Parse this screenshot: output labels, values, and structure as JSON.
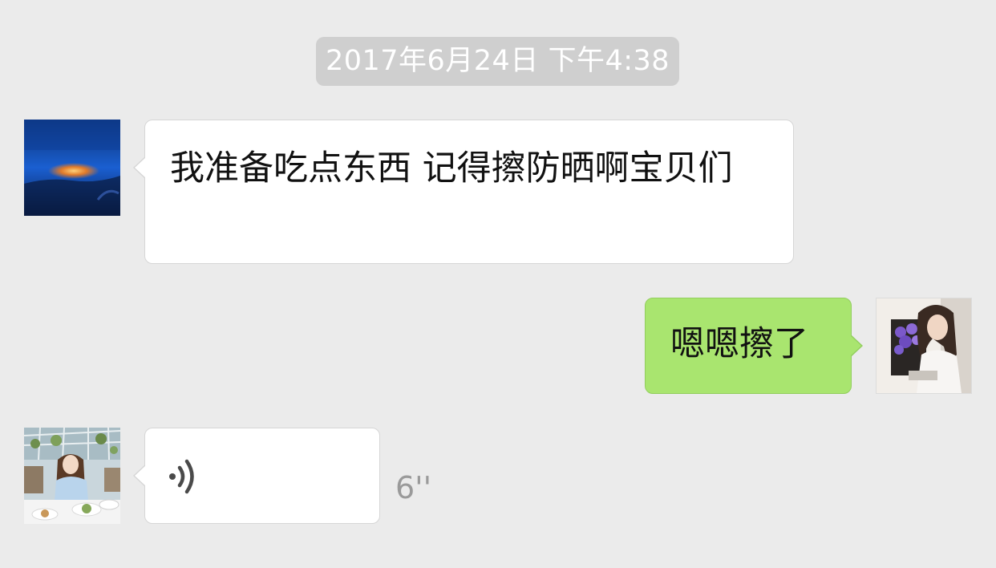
{
  "chat": {
    "timestamp": "2017年6月24日 下午4:38",
    "messages": [
      {
        "side": "left",
        "type": "text",
        "text": "我准备吃点东西 记得擦防晒啊宝贝们"
      },
      {
        "side": "right",
        "type": "text",
        "text": "嗯嗯擦了"
      },
      {
        "side": "left",
        "type": "voice",
        "duration": "6''",
        "icon": "voice-wave-icon"
      }
    ]
  },
  "colors": {
    "background": "#ebebeb",
    "incoming_bubble": "#ffffff",
    "outgoing_bubble": "#a9e56f",
    "timestamp_pill": "#cfcfcf",
    "duration_text": "#9a9a9a"
  }
}
